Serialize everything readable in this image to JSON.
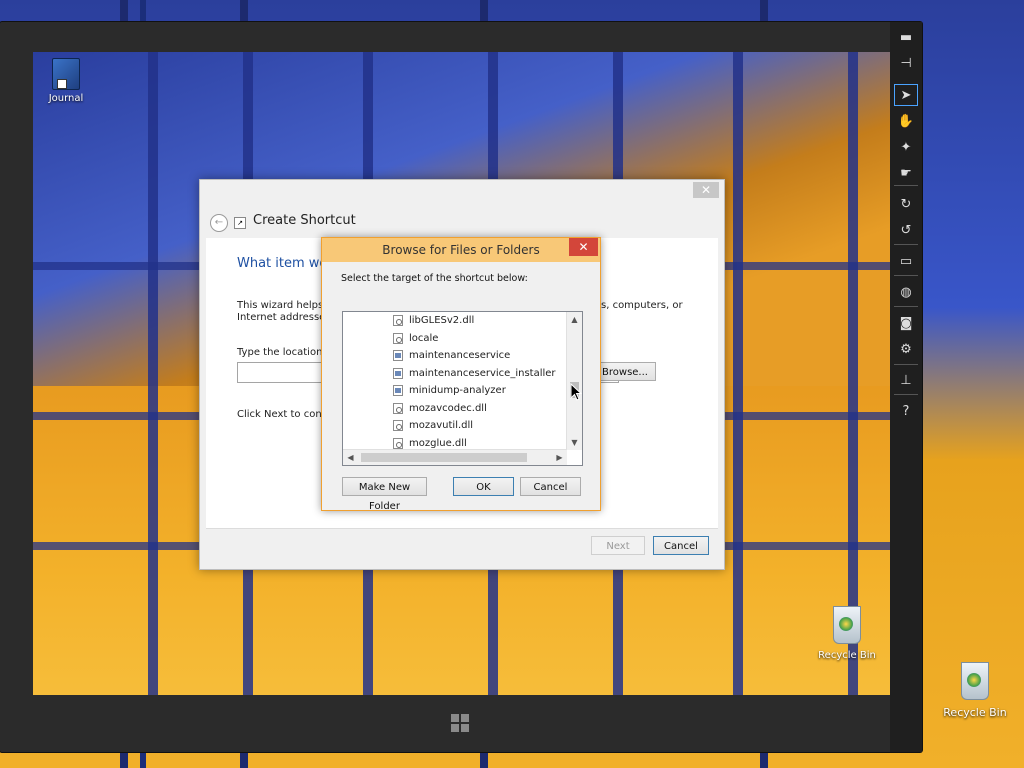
{
  "desktop": {
    "icons": [
      {
        "label": "Journal"
      },
      {
        "label": "Recycle Bin"
      },
      {
        "label": "Recycle Bin"
      }
    ]
  },
  "toolbar": {
    "buttons": [
      {
        "icon": "minimize-icon"
      },
      {
        "icon": "pin-icon"
      },
      {
        "icon": "pointer-icon",
        "active": true
      },
      {
        "icon": "hand-icon"
      },
      {
        "icon": "touch-icon"
      },
      {
        "icon": "gesture-icon"
      },
      {
        "icon": "rotate-right-icon"
      },
      {
        "icon": "rotate-left-icon"
      },
      {
        "icon": "monitor-icon"
      },
      {
        "icon": "globe-icon"
      },
      {
        "icon": "camera-icon"
      },
      {
        "icon": "gear-icon"
      },
      {
        "icon": "network-icon"
      },
      {
        "icon": "help-icon"
      }
    ]
  },
  "wizard": {
    "title": "Create Shortcut",
    "heading": "What item wou",
    "description_line1": "This wizard helps y",
    "description_line1_end": "s, computers, or",
    "description_line2": "Internet addresses.",
    "location_label": "Type the location o",
    "browse_label": "Browse...",
    "next_hint": "Click Next to contin",
    "next_label": "Next",
    "cancel_label": "Cancel"
  },
  "browse_dialog": {
    "title": "Browse for Files or Folders",
    "prompt": "Select the target of the shortcut below:",
    "items": [
      {
        "name": "libGLESv2.dll",
        "type": "dll"
      },
      {
        "name": "locale",
        "type": "file"
      },
      {
        "name": "maintenanceservice",
        "type": "app"
      },
      {
        "name": "maintenanceservice_installer",
        "type": "app"
      },
      {
        "name": "minidump-analyzer",
        "type": "app"
      },
      {
        "name": "mozavcodec.dll",
        "type": "dll"
      },
      {
        "name": "mozavutil.dll",
        "type": "dll"
      },
      {
        "name": "mozglue.dll",
        "type": "dll"
      }
    ],
    "make_folder_label": "Make New Folder",
    "ok_label": "OK",
    "cancel_label": "Cancel"
  },
  "colors": {
    "accent_orange": "#f8c877",
    "close_red": "#d3463a",
    "heading_blue": "#1e50a2"
  }
}
